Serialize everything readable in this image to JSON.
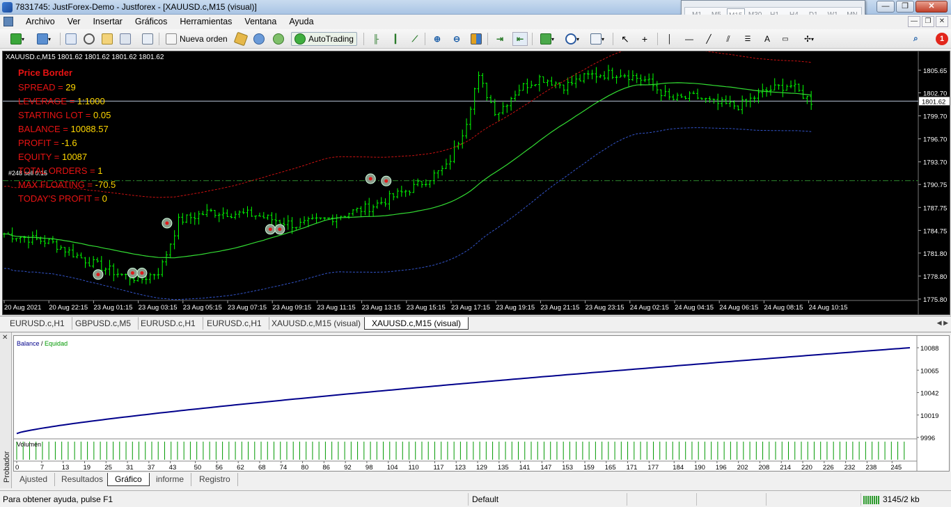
{
  "window": {
    "title": "7831745: JustForex-Demo - Justforex - [XAUUSD.c,M15 (visual)]",
    "controls": [
      "—",
      "❐",
      "✕"
    ]
  },
  "timeframes": [
    "M1",
    "M5",
    "M15",
    "M30",
    "H1",
    "H4",
    "D1",
    "W1",
    "MN"
  ],
  "active_timeframe": "M15",
  "menu": [
    "Archivo",
    "Ver",
    "Insertar",
    "Gráficos",
    "Herramientas",
    "Ventana",
    "Ayuda"
  ],
  "toolbar": {
    "new_order": "Nueva orden",
    "autotrading": "AutoTrading",
    "notifications": "1"
  },
  "chart": {
    "symbol_line": "XAUUSD.c,M15  1801.62 1801.62 1801.62 1801.62",
    "current_price": "1801.62",
    "price_levels": [
      "1805.65",
      "1802.70",
      "1799.70",
      "1796.70",
      "1793.70",
      "1790.75",
      "1787.75",
      "1784.75",
      "1781.80",
      "1778.80",
      "1775.80"
    ],
    "time_labels": [
      "20 Aug 2021",
      "20 Aug 22:15",
      "23 Aug 01:15",
      "23 Aug 03:15",
      "23 Aug 05:15",
      "23 Aug 07:15",
      "23 Aug 09:15",
      "23 Aug 11:15",
      "23 Aug 13:15",
      "23 Aug 15:15",
      "23 Aug 17:15",
      "23 Aug 19:15",
      "23 Aug 21:15",
      "23 Aug 23:15",
      "24 Aug 02:15",
      "24 Aug 04:15",
      "24 Aug 06:15",
      "24 Aug 08:15",
      "24 Aug 10:15"
    ],
    "order_label": "#248 sell 0.15",
    "info": {
      "title": "Price Border",
      "rows": [
        {
          "label": "SPREAD = ",
          "value": "29"
        },
        {
          "label": "LEVERAGE = ",
          "value": "1:1000"
        },
        {
          "label": "STARTING LOT = ",
          "value": "0.05"
        },
        {
          "label": "BALANCE = ",
          "value": "10088.57"
        },
        {
          "label": "PROFIT = ",
          "value": "-1.6"
        },
        {
          "label": "EQUITY = ",
          "value": "10087"
        },
        {
          "label": "TOTAL ORDERS = ",
          "value": "1"
        },
        {
          "label": "MAX FLOATING = ",
          "value": "-70.5"
        },
        {
          "label": "TODAY'S PROFIT = ",
          "value": "0"
        }
      ]
    },
    "colors": {
      "background": "#000000",
      "candles": "#00ff00",
      "ma": "#33dd33",
      "upper_band": "#cc1111",
      "lower_band": "#3355cc",
      "price_line": "#b8c4d8",
      "order_line": "#2e8b2e"
    }
  },
  "chart_tabs": [
    "EURUSD.c,H1",
    "GBPUSD.c,M5",
    "EURUSD.c,H1",
    "EURUSD.c,H1",
    "XAUUSD.c,M15 (visual)",
    "XAUUSD.c,M15 (visual)"
  ],
  "active_chart_tab": 5,
  "tester": {
    "side_label": "Probador",
    "legend_balance": "Balance",
    "legend_sep": " / ",
    "legend_equity": "Equidad",
    "volume_label": "Volumen",
    "y_labels": [
      "10088",
      "10065",
      "10042",
      "10019",
      "9996"
    ],
    "x_labels": [
      "0",
      "7",
      "13",
      "19",
      "25",
      "31",
      "37",
      "43",
      "50",
      "56",
      "62",
      "68",
      "74",
      "80",
      "86",
      "92",
      "98",
      "104",
      "110",
      "117",
      "123",
      "129",
      "135",
      "141",
      "147",
      "153",
      "159",
      "165",
      "171",
      "177",
      "184",
      "190",
      "196",
      "202",
      "208",
      "214",
      "220",
      "226",
      "232",
      "238",
      "245"
    ],
    "tabs": [
      "Ajusted",
      "Resultados",
      "Gráfico",
      "informe",
      "Registro"
    ],
    "active_tab": 2,
    "colors": {
      "balance": "#00008b",
      "volume": "#009900"
    }
  },
  "status": {
    "help": "Para obtener ayuda, pulse F1",
    "profile": "Default",
    "traffic": "3145/2 kb"
  }
}
